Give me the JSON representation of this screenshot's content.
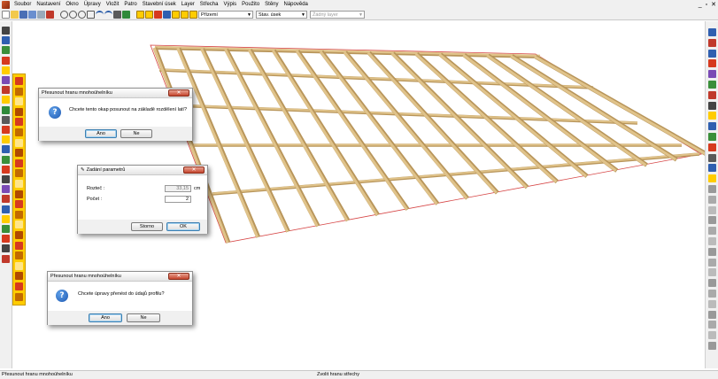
{
  "menu": {
    "items": [
      "Soubor",
      "Nastavení",
      "Okno",
      "Úpravy",
      "Vložit",
      "Patro",
      "Stavební úsek",
      "Layer",
      "Střecha",
      "Výpis",
      "Použito",
      "Stěny",
      "Nápověda"
    ],
    "window_controls": [
      "_",
      "▫",
      "✕"
    ]
  },
  "toolbar": {
    "combo_view": "Přízemí",
    "combo_section": "Stav. úsek",
    "combo_layer": "Žádný layer"
  },
  "dialog1": {
    "title": "Přesunout hranu mnohoúhelníku",
    "message": "Chcete tento okap posunout na základě rozdělení latí?",
    "yes_label": "Ano",
    "no_label": "Ne"
  },
  "dialog2": {
    "title": "Zadání parametrů",
    "rozted_label": "Rozteč :",
    "rozted_value": "33,15",
    "rozted_unit": "cm",
    "pocet_label": "Počet :",
    "pocet_value": "2",
    "storno_label": "Storno",
    "ok_label": "OK"
  },
  "dialog3": {
    "title": "Přesunout hranu mnohoúhelníku",
    "message": "Chcete úpravy přenést do údajů profilu?",
    "yes_label": "Ano",
    "no_label": "Ne"
  },
  "status": {
    "left": "Přesunout hranu mnohoúhelníku",
    "middle": "Zvolit hranu střechy"
  },
  "colors": {
    "timber": "#e0c38a",
    "timber_dark": "#b8955a",
    "roof_outline": "#d64545",
    "accent_toolbar": "#ffcc00"
  },
  "icons": [
    "cursor-icon",
    "question-icon",
    "close-icon",
    "new-file-icon",
    "open-icon",
    "save-icon",
    "print-icon",
    "zoom-icon",
    "undo-icon",
    "redo-icon"
  ]
}
